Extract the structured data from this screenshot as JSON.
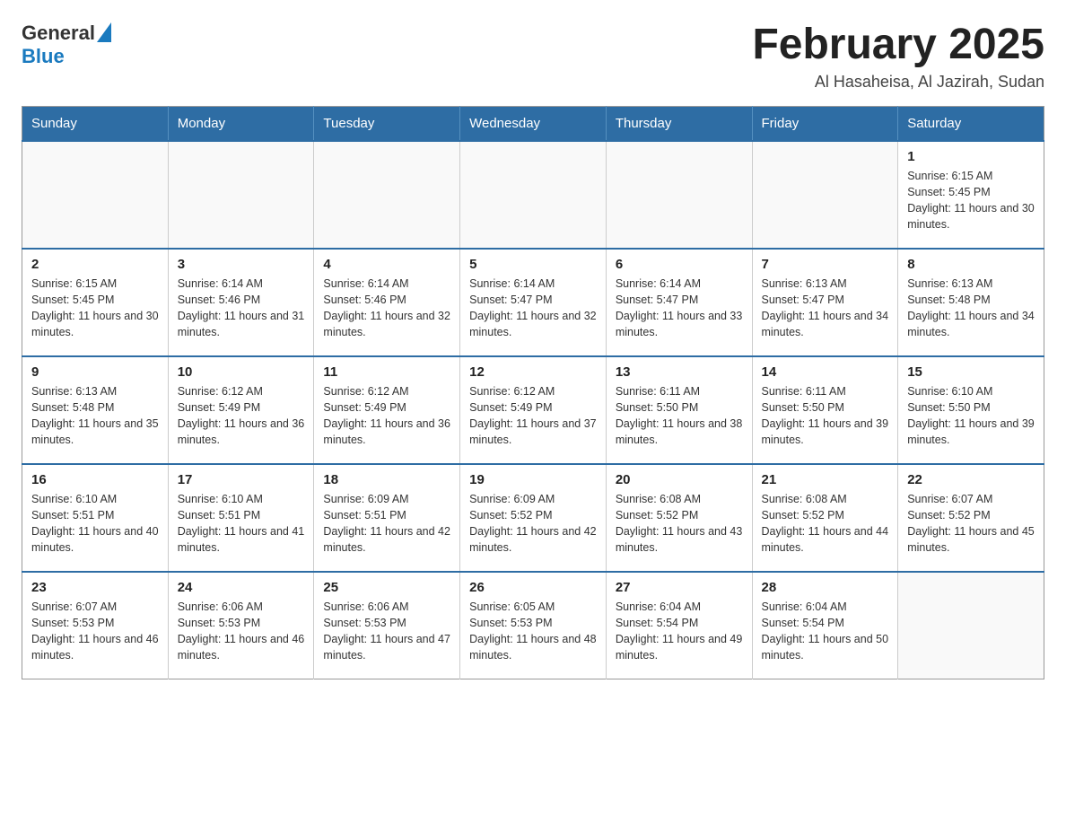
{
  "logo": {
    "general": "General",
    "blue": "Blue"
  },
  "title": "February 2025",
  "location": "Al Hasaheisa, Al Jazirah, Sudan",
  "days_of_week": [
    "Sunday",
    "Monday",
    "Tuesday",
    "Wednesday",
    "Thursday",
    "Friday",
    "Saturday"
  ],
  "weeks": [
    [
      {
        "day": "",
        "info": ""
      },
      {
        "day": "",
        "info": ""
      },
      {
        "day": "",
        "info": ""
      },
      {
        "day": "",
        "info": ""
      },
      {
        "day": "",
        "info": ""
      },
      {
        "day": "",
        "info": ""
      },
      {
        "day": "1",
        "info": "Sunrise: 6:15 AM\nSunset: 5:45 PM\nDaylight: 11 hours and 30 minutes."
      }
    ],
    [
      {
        "day": "2",
        "info": "Sunrise: 6:15 AM\nSunset: 5:45 PM\nDaylight: 11 hours and 30 minutes."
      },
      {
        "day": "3",
        "info": "Sunrise: 6:14 AM\nSunset: 5:46 PM\nDaylight: 11 hours and 31 minutes."
      },
      {
        "day": "4",
        "info": "Sunrise: 6:14 AM\nSunset: 5:46 PM\nDaylight: 11 hours and 32 minutes."
      },
      {
        "day": "5",
        "info": "Sunrise: 6:14 AM\nSunset: 5:47 PM\nDaylight: 11 hours and 32 minutes."
      },
      {
        "day": "6",
        "info": "Sunrise: 6:14 AM\nSunset: 5:47 PM\nDaylight: 11 hours and 33 minutes."
      },
      {
        "day": "7",
        "info": "Sunrise: 6:13 AM\nSunset: 5:47 PM\nDaylight: 11 hours and 34 minutes."
      },
      {
        "day": "8",
        "info": "Sunrise: 6:13 AM\nSunset: 5:48 PM\nDaylight: 11 hours and 34 minutes."
      }
    ],
    [
      {
        "day": "9",
        "info": "Sunrise: 6:13 AM\nSunset: 5:48 PM\nDaylight: 11 hours and 35 minutes."
      },
      {
        "day": "10",
        "info": "Sunrise: 6:12 AM\nSunset: 5:49 PM\nDaylight: 11 hours and 36 minutes."
      },
      {
        "day": "11",
        "info": "Sunrise: 6:12 AM\nSunset: 5:49 PM\nDaylight: 11 hours and 36 minutes."
      },
      {
        "day": "12",
        "info": "Sunrise: 6:12 AM\nSunset: 5:49 PM\nDaylight: 11 hours and 37 minutes."
      },
      {
        "day": "13",
        "info": "Sunrise: 6:11 AM\nSunset: 5:50 PM\nDaylight: 11 hours and 38 minutes."
      },
      {
        "day": "14",
        "info": "Sunrise: 6:11 AM\nSunset: 5:50 PM\nDaylight: 11 hours and 39 minutes."
      },
      {
        "day": "15",
        "info": "Sunrise: 6:10 AM\nSunset: 5:50 PM\nDaylight: 11 hours and 39 minutes."
      }
    ],
    [
      {
        "day": "16",
        "info": "Sunrise: 6:10 AM\nSunset: 5:51 PM\nDaylight: 11 hours and 40 minutes."
      },
      {
        "day": "17",
        "info": "Sunrise: 6:10 AM\nSunset: 5:51 PM\nDaylight: 11 hours and 41 minutes."
      },
      {
        "day": "18",
        "info": "Sunrise: 6:09 AM\nSunset: 5:51 PM\nDaylight: 11 hours and 42 minutes."
      },
      {
        "day": "19",
        "info": "Sunrise: 6:09 AM\nSunset: 5:52 PM\nDaylight: 11 hours and 42 minutes."
      },
      {
        "day": "20",
        "info": "Sunrise: 6:08 AM\nSunset: 5:52 PM\nDaylight: 11 hours and 43 minutes."
      },
      {
        "day": "21",
        "info": "Sunrise: 6:08 AM\nSunset: 5:52 PM\nDaylight: 11 hours and 44 minutes."
      },
      {
        "day": "22",
        "info": "Sunrise: 6:07 AM\nSunset: 5:52 PM\nDaylight: 11 hours and 45 minutes."
      }
    ],
    [
      {
        "day": "23",
        "info": "Sunrise: 6:07 AM\nSunset: 5:53 PM\nDaylight: 11 hours and 46 minutes."
      },
      {
        "day": "24",
        "info": "Sunrise: 6:06 AM\nSunset: 5:53 PM\nDaylight: 11 hours and 46 minutes."
      },
      {
        "day": "25",
        "info": "Sunrise: 6:06 AM\nSunset: 5:53 PM\nDaylight: 11 hours and 47 minutes."
      },
      {
        "day": "26",
        "info": "Sunrise: 6:05 AM\nSunset: 5:53 PM\nDaylight: 11 hours and 48 minutes."
      },
      {
        "day": "27",
        "info": "Sunrise: 6:04 AM\nSunset: 5:54 PM\nDaylight: 11 hours and 49 minutes."
      },
      {
        "day": "28",
        "info": "Sunrise: 6:04 AM\nSunset: 5:54 PM\nDaylight: 11 hours and 50 minutes."
      },
      {
        "day": "",
        "info": ""
      }
    ]
  ]
}
